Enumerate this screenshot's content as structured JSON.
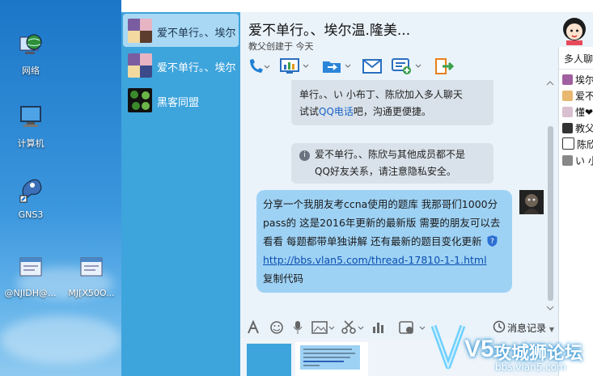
{
  "desktop": {
    "icons": [
      {
        "label": "网络",
        "icon": "network-globe-icon"
      },
      {
        "label": "计算机",
        "icon": "computer-icon"
      },
      {
        "label": "GNS3",
        "icon": "gns3-icon"
      },
      {
        "label": "@NJIDH@...",
        "icon": "window-shortcut-icon"
      },
      {
        "label": "MJ[X50O...",
        "icon": "window-shortcut-icon"
      }
    ]
  },
  "chat_list": [
    {
      "name": "爱不单行。、埃尔",
      "selected": true
    },
    {
      "name": "爱不单行。、埃尔",
      "selected": false
    },
    {
      "name": "黑客同盟",
      "selected": false
    }
  ],
  "header": {
    "title": "爱不单行。、埃尔温.隆美...",
    "subtitle": "教父创建于 今天"
  },
  "messages": {
    "sys1_line1": "单行。、い 小布丁、陈欣加入多人聊天",
    "sys1_line2_pre": "试试",
    "sys1_link": "QQ电话",
    "sys1_line2_post": "吧，沟通更便捷。",
    "sys2_line1": "爱不单行。、陈欣与其他成员都不是",
    "sys2_line2": "QQ好友关系，请注意隐私安全。",
    "bubble_text": "分享一个我朋友考ccna使用的题库 我那哥们1000分pass的 这是2016年更新的最新版 需要的朋友可以去看看 每题都带单独讲解 还有最新的题目变化更新",
    "bubble_url": "http://bbs.vlan5.com/thread-17810-1-1.html",
    "bubble_copy": "复制代码"
  },
  "inputbar": {
    "history_label": "消息记录"
  },
  "right_panel": {
    "header_label": "多人聊",
    "members": [
      "埃尔",
      "爱不",
      "懂❤",
      "教父",
      "陈欣",
      "い 小"
    ]
  },
  "watermark": {
    "logo": "V5",
    "title": "攻城狮论坛",
    "url": "bbs.vlan5.com"
  },
  "colors": {
    "chat_list_bg": "#3ea4dc",
    "bubble_bg": "#9ed2f5",
    "link": "#1a63c8"
  }
}
